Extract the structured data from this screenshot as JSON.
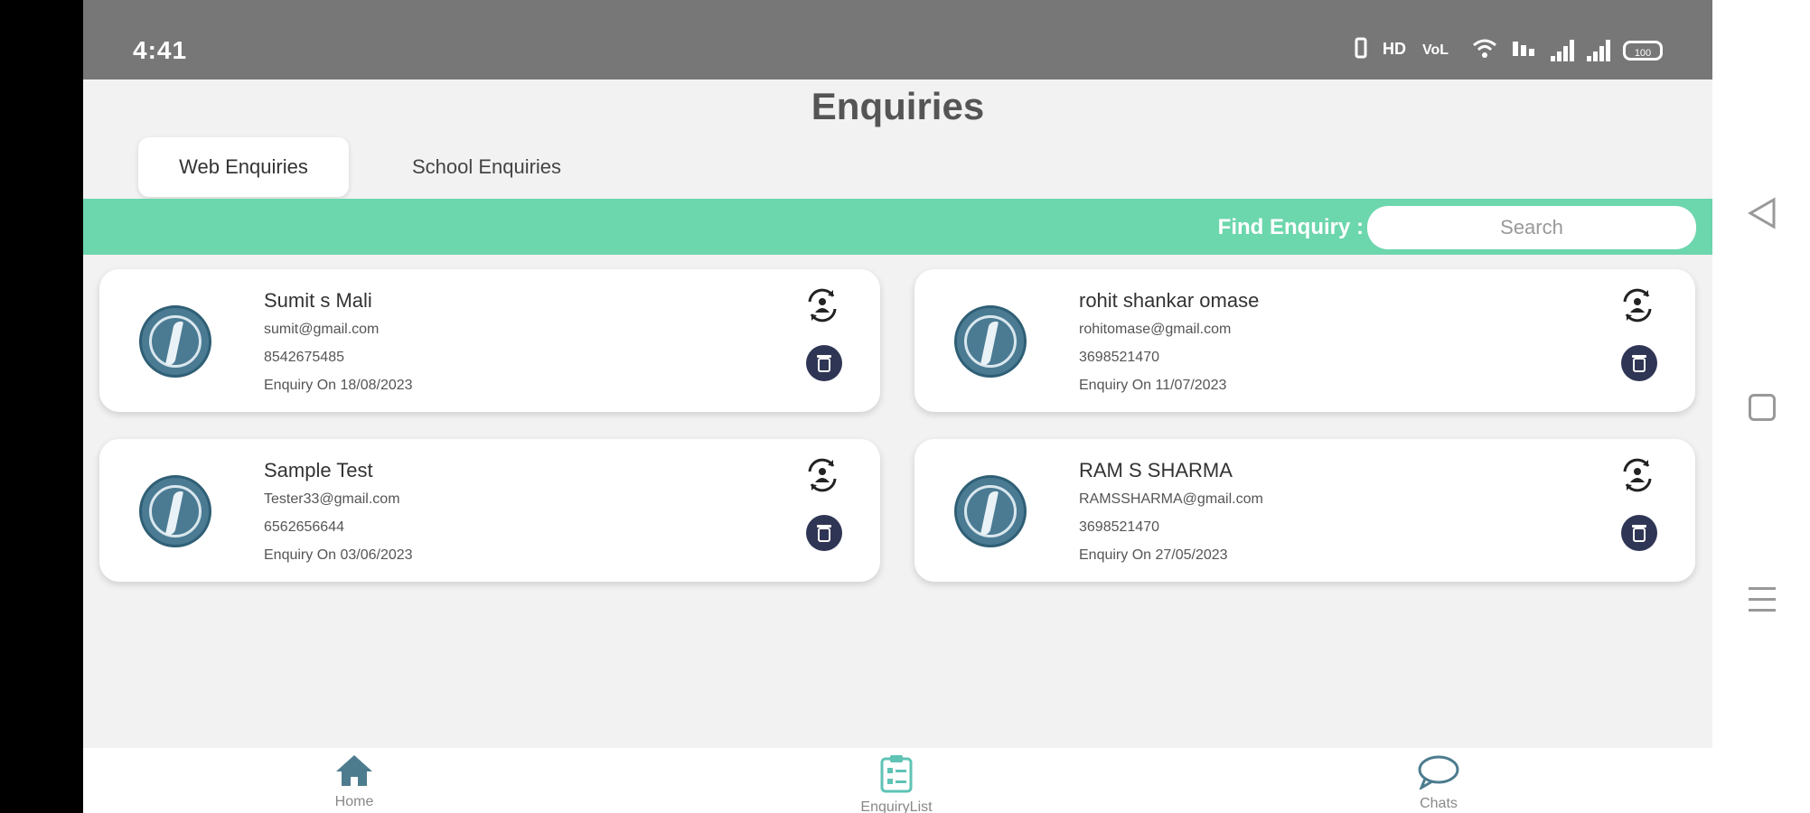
{
  "status": {
    "time": "4:41",
    "battery": "100"
  },
  "page": {
    "title": "Enquiries"
  },
  "tabs": [
    {
      "label": "Web Enquiries",
      "active": true
    },
    {
      "label": "School Enquiries",
      "active": false
    }
  ],
  "search": {
    "label": "Find Enquiry :",
    "placeholder": "Search"
  },
  "enquiries": [
    {
      "name": "Sumit s Mali",
      "email": "sumit@gmail.com",
      "phone": "8542675485",
      "date": "Enquiry On 18/08/2023"
    },
    {
      "name": "rohit shankar omase",
      "email": "rohitomase@gmail.com",
      "phone": "3698521470",
      "date": "Enquiry On 11/07/2023"
    },
    {
      "name": "Sample Test",
      "email": "Tester33@gmail.com",
      "phone": "6562656644",
      "date": "Enquiry On 03/06/2023"
    },
    {
      "name": "RAM S SHARMA",
      "email": "RAMSSHARMA@gmail.com",
      "phone": "3698521470",
      "date": "Enquiry On 27/05/2023"
    }
  ],
  "nav": {
    "home": "Home",
    "enquiry_list": "EnquiryList",
    "chats": "Chats"
  },
  "colors": {
    "accent_green": "#6cd6ad",
    "avatar_blue": "#4b7b93",
    "delete_navy": "#2f3554",
    "nav_active": "#5fc3b5",
    "nav_inactive": "#4d7c8e"
  },
  "icons": {
    "swap": "swap-person-icon",
    "delete": "trash-icon",
    "home": "home-icon",
    "enquiry_list": "clipboard-icon",
    "chats": "chat-bubble-icon"
  }
}
